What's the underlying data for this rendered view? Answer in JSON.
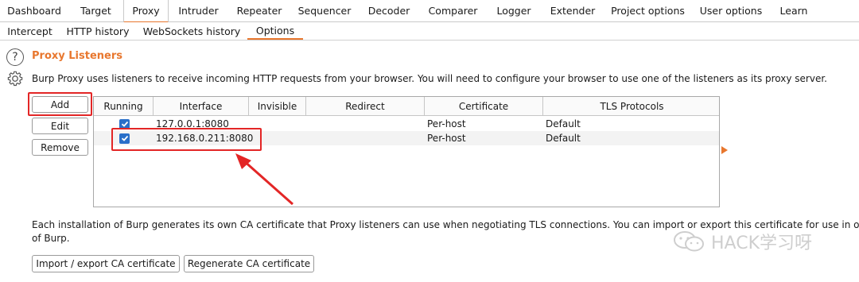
{
  "tabs_top": [
    "Dashboard",
    "Target",
    "Proxy",
    "Intruder",
    "Repeater",
    "Sequencer",
    "Decoder",
    "Comparer",
    "Logger",
    "Extender",
    "Project options",
    "User options",
    "Learn"
  ],
  "tabs_sub": [
    "Intercept",
    "HTTP history",
    "WebSockets history",
    "Options"
  ],
  "section": {
    "title": "Proxy Listeners",
    "description": "Burp Proxy uses listeners to receive incoming HTTP requests from your browser. You will need to configure your browser to use one of the listeners as its proxy server."
  },
  "buttons": {
    "add": "Add",
    "edit": "Edit",
    "remove": "Remove"
  },
  "table": {
    "headers": [
      "Running",
      "Interface",
      "Invisible",
      "Redirect",
      "Certificate",
      "TLS Protocols"
    ],
    "rows": [
      {
        "running": true,
        "interface": "127.0.0.1:8080",
        "invisible": "",
        "redirect": "",
        "certificate": "Per-host",
        "tls": "Default"
      },
      {
        "running": true,
        "interface": "192.168.0.211:8080",
        "invisible": "",
        "redirect": "",
        "certificate": "Per-host",
        "tls": "Default"
      }
    ]
  },
  "ca_info": {
    "line1": "Each installation of Burp generates its own CA certificate that Proxy listeners can use when negotiating TLS connections. You can import or export this certificate for use in other tools or another installation",
    "line2": "of Burp."
  },
  "ca_buttons": {
    "import_export": "Import / export CA certificate",
    "regenerate": "Regenerate CA certificate"
  },
  "watermark": "HACK学习呀",
  "colors": {
    "accent": "#e8772e",
    "highlight": "#e32626",
    "checkbox": "#2a6fc9"
  }
}
